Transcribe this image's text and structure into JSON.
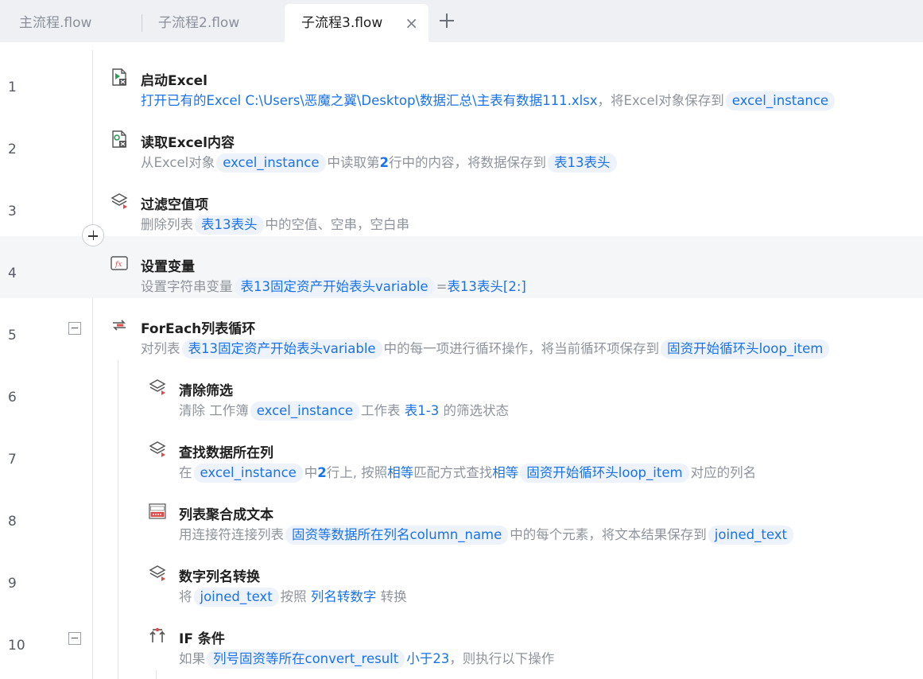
{
  "tabs": [
    {
      "label": "主流程.flow"
    },
    {
      "label": "子流程2.flow"
    },
    {
      "label": "子流程3.flow",
      "close": "×"
    }
  ],
  "steps": [
    {
      "no": "1",
      "title": "启动Excel",
      "d": [
        "打开已有的Excel C:\\Users\\恶魔之翼\\Desktop\\数据汇总\\主表有数据111.xlsx",
        "，将Excel对象保存到",
        "excel_instance"
      ]
    },
    {
      "no": "2",
      "title": "读取Excel内容",
      "d": [
        "从Excel对象",
        "excel_instance",
        "中读取第",
        "2",
        "行中的内容，将数据保存到",
        "表13表头"
      ]
    },
    {
      "no": "3",
      "title": "过滤空值项",
      "d": [
        "删除列表",
        "表13表头",
        "中的空值、空串，空白串"
      ]
    },
    {
      "no": "4",
      "title": "设置变量",
      "d": [
        "设置字符串变量",
        "表13固定资产开始表头variable",
        "=",
        "表13表头[2:]"
      ]
    },
    {
      "no": "5",
      "title": "ForEach列表循环",
      "d": [
        "对列表",
        "表13固定资产开始表头variable",
        "中的每一项进行循环操作，将当前循环项保存到",
        "固资开始循环头loop_item"
      ]
    },
    {
      "no": "6",
      "title": "清除筛选",
      "d": [
        "清除 工作簿",
        "excel_instance",
        "工作表 ",
        "表1-3",
        " 的筛选状态"
      ]
    },
    {
      "no": "7",
      "title": "查找数据所在列",
      "d": [
        "在",
        "excel_instance",
        "中",
        "2",
        "行上, 按照",
        "相等",
        "匹配方式查找",
        "相等",
        "固资开始循环头loop_item",
        "对应的列名"
      ]
    },
    {
      "no": "8",
      "title": "列表聚合成文本",
      "d": [
        "用连接符连接列表",
        "固资等数据所在列名column_name",
        "中的每个元素，将文本结果保存到",
        "joined_text"
      ]
    },
    {
      "no": "9",
      "title": "数字列名转换",
      "d": [
        "将",
        "joined_text",
        "按照 ",
        "列名转数字",
        " 转换"
      ]
    },
    {
      "no": "10",
      "title": "IF 条件",
      "d": [
        "如果",
        "列号固资等所在convert_result",
        "小于",
        "23",
        "，则执行以下操作"
      ]
    }
  ],
  "colors": {
    "accent": "#1a73e8",
    "chip_bg": "#eef3fb",
    "highlight_row": "#f5f6f8"
  }
}
